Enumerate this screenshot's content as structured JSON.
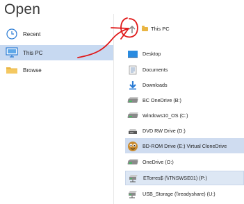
{
  "window": {
    "title": "Open"
  },
  "nav": {
    "items": [
      {
        "label": "Recent",
        "icon": "clock-icon"
      },
      {
        "label": "This PC",
        "icon": "computer-icon",
        "selected": true
      },
      {
        "label": "Browse",
        "icon": "folder-icon"
      }
    ]
  },
  "address": {
    "up_icon": "up-arrow-icon",
    "crumb_label": "This PC"
  },
  "locations": [
    {
      "label": "Desktop",
      "icon": "desktop-icon"
    },
    {
      "label": "Documents",
      "icon": "documents-icon"
    },
    {
      "label": "Downloads",
      "icon": "downloads-icon"
    },
    {
      "label": "BC OneDrive (B:)",
      "icon": "drive-icon"
    },
    {
      "label": "Windows10_OS (C:)",
      "icon": "drive-icon"
    },
    {
      "label": "DVD RW Drive (D:)",
      "icon": "dvd-drive-icon"
    },
    {
      "label": "BD-ROM Drive (E:) Virtual CloneDrive",
      "icon": "clonedrive-icon"
    },
    {
      "label": "OneDrive (O:)",
      "icon": "drive-icon"
    },
    {
      "label": "ETorres$ (\\\\TNSWSE01) (P:)",
      "icon": "network-drive-icon"
    },
    {
      "label": "USB_Storage (\\\\readyshare) (U:)",
      "icon": "network-drive-icon"
    }
  ],
  "colors": {
    "selection": "#c7d9f1",
    "annotation": "#e01a1a",
    "folder": "#e9b543",
    "accent": "#2a7bd4"
  }
}
